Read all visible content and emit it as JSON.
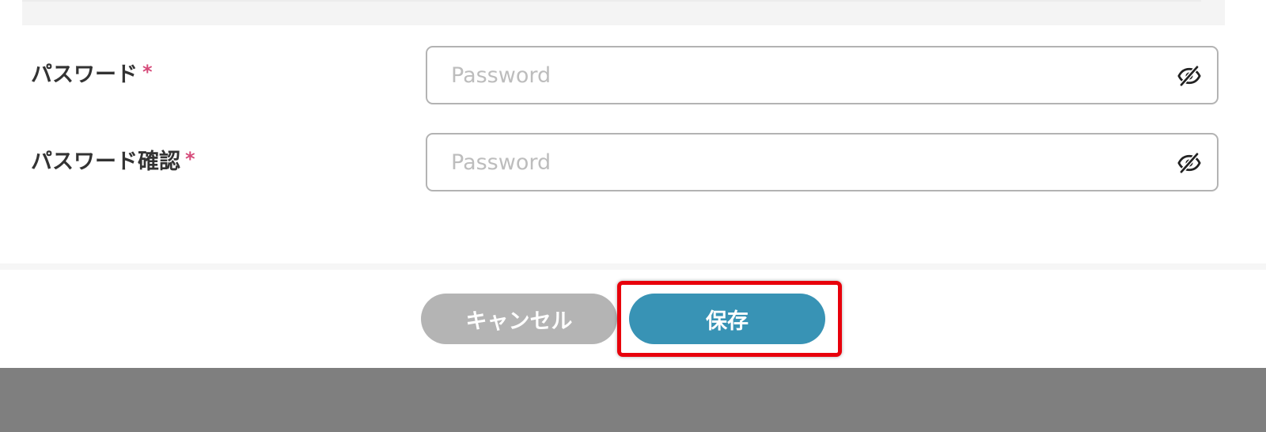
{
  "form": {
    "password": {
      "label": "パスワード",
      "required_mark": "*",
      "value": "",
      "placeholder": "Password",
      "toggle_icon": "eye-off-icon"
    },
    "password_confirm": {
      "label": "パスワード確認",
      "required_mark": "*",
      "value": "",
      "placeholder": "Password",
      "toggle_icon": "eye-off-icon"
    }
  },
  "footer": {
    "cancel_label": "キャンセル",
    "save_label": "保存"
  },
  "colors": {
    "required": "#d64b7a",
    "save_button": "#3893b5",
    "cancel_button": "#b4b4b4",
    "highlight": "#e8000b",
    "backdrop": "#7f7f7f"
  }
}
